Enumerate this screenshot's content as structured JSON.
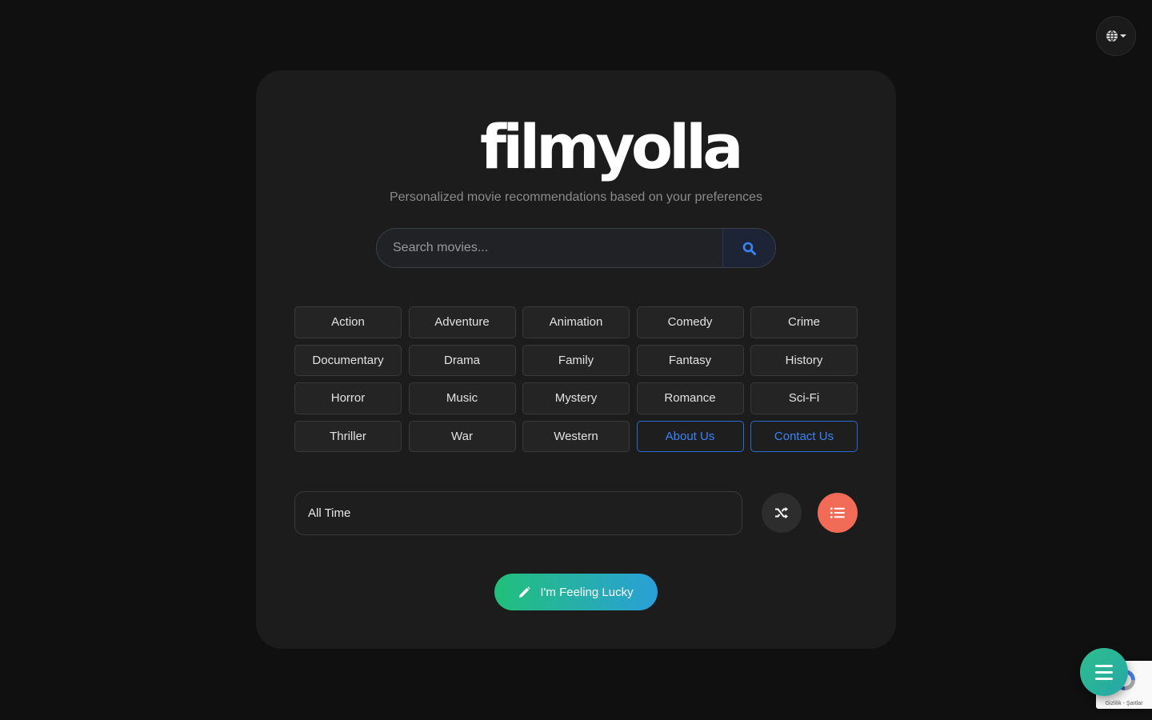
{
  "header": {
    "language_icon": "globe-icon"
  },
  "logo": {
    "text": "filmyolla",
    "arrow_colors": [
      "#2ecc71",
      "#3b82f6"
    ]
  },
  "tagline": "Personalized movie recommendations based on your preferences",
  "search": {
    "placeholder": "Search movies...",
    "icon": "search-icon",
    "icon_color": "#3b82f6"
  },
  "genres": [
    "Action",
    "Adventure",
    "Animation",
    "Comedy",
    "Crime",
    "Documentary",
    "Drama",
    "Family",
    "Fantasy",
    "History",
    "Horror",
    "Music",
    "Mystery",
    "Romance",
    "Sci-Fi",
    "Thriller",
    "War",
    "Western"
  ],
  "links": {
    "about": "About Us",
    "contact": "Contact Us"
  },
  "filters": {
    "time_range": "All Time",
    "shuffle_icon": "shuffle-icon",
    "list_icon": "list-icon"
  },
  "lucky": {
    "label": "I'm Feeling Lucky",
    "icon": "pencil-icon"
  },
  "recaptcha": {
    "text": "Gizlilik - Şartlar"
  },
  "fab": {
    "icon": "hamburger-menu-icon"
  },
  "colors": {
    "background": "#101010",
    "card": "#1c1c1c",
    "accent": "#3b82f6",
    "list_button": "#f26b57",
    "lucky_from": "#22c07a",
    "lucky_to": "#2a9fd8"
  }
}
